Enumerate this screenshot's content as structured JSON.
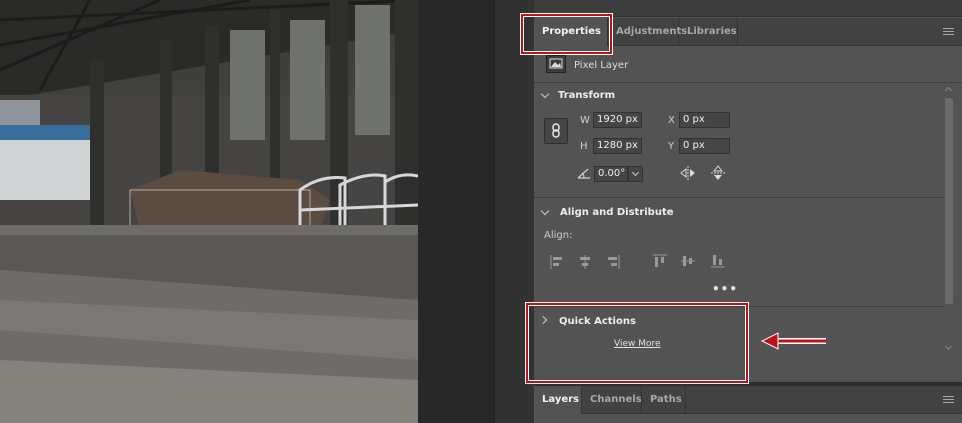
{
  "canvas": {
    "image": "warehouse-photo"
  },
  "panel": {
    "tabs": [
      {
        "label": "Properties",
        "active": true
      },
      {
        "label": "Adjustments",
        "active": false
      },
      {
        "label": "Libraries",
        "active": false
      }
    ],
    "layer_type": "Pixel Layer",
    "transform": {
      "title": "Transform",
      "w_label": "W",
      "w_value": "1920 px",
      "h_label": "H",
      "h_value": "1280 px",
      "x_label": "X",
      "x_value": "0 px",
      "y_label": "Y",
      "y_value": "0 px",
      "angle_value": "0.00°"
    },
    "align": {
      "title": "Align and Distribute",
      "label": "Align:",
      "more": "•••"
    },
    "quick_actions": {
      "title": "Quick Actions",
      "view_more": "View More"
    },
    "bottom_tabs": [
      {
        "label": "Layers",
        "active": true
      },
      {
        "label": "Channels",
        "active": false
      },
      {
        "label": "Paths",
        "active": false
      }
    ]
  },
  "annotation": {
    "highlight_color": "#c0101a",
    "arrow_direction": "left"
  },
  "colors": {
    "panel_bg": "#535353",
    "tabbar_bg": "#424242",
    "highlight": "#c0101a"
  }
}
